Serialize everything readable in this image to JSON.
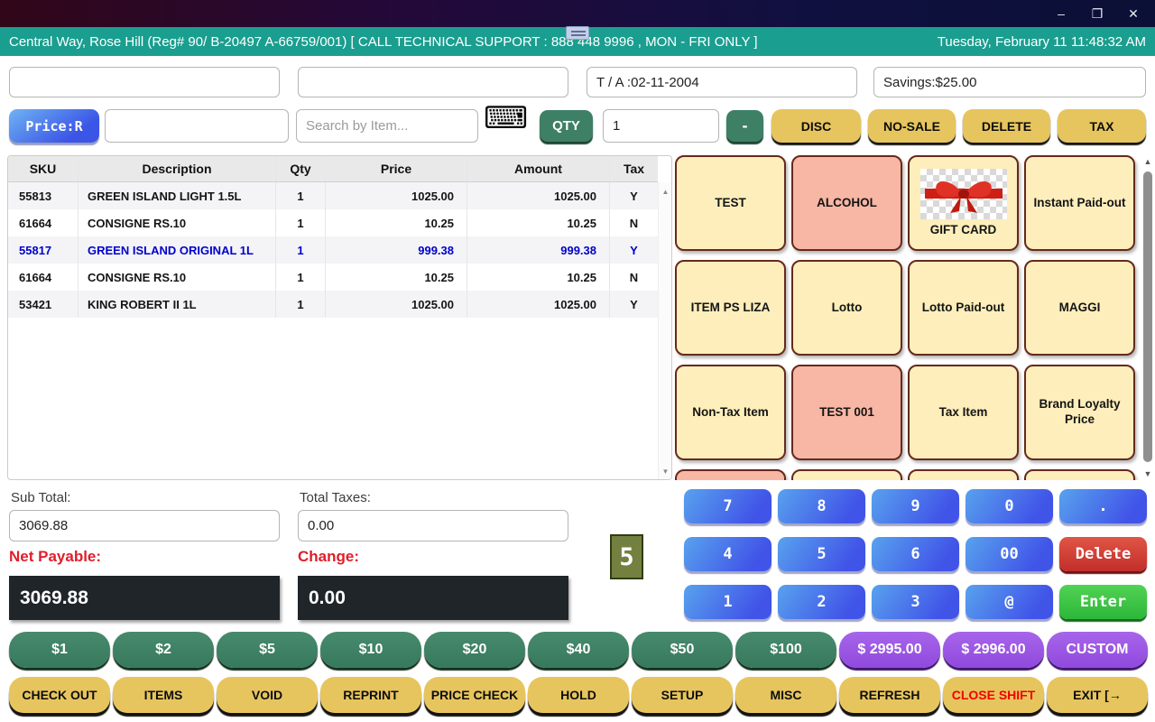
{
  "titlebar": {
    "minimize": "–",
    "restore": "❐",
    "close": "✕"
  },
  "header": {
    "store_info": "Central Way, Rose Hill (Reg# 90/ B-20497 A-66759/001) [ CALL TECHNICAL SUPPORT : 888 448 9996 , MON - FRI ONLY ]",
    "datetime": "Tuesday, February 11 11:48:32 AM"
  },
  "topbar": {
    "field1_value": "",
    "field2_value": "",
    "transaction_date": "T / A :02-11-2004",
    "savings": "Savings:$25.00"
  },
  "actionbar": {
    "price_mode": "Price:R",
    "item_code_value": "",
    "search_placeholder": "Search by Item...",
    "keyboard_icon": "⌨",
    "qty_label": "QTY",
    "qty_value": "1",
    "minus_label": "-",
    "disc": "DISC",
    "no_sale": "NO-SALE",
    "delete": "DELETE",
    "tax": "TAX"
  },
  "table": {
    "headers": [
      {
        "key": "sku",
        "label": "SKU"
      },
      {
        "key": "description",
        "label": "Description"
      },
      {
        "key": "qty",
        "label": "Qty"
      },
      {
        "key": "price",
        "label": "Price"
      },
      {
        "key": "amount",
        "label": "Amount"
      },
      {
        "key": "tax",
        "label": "Tax"
      }
    ],
    "rows": [
      {
        "sku": "55813",
        "description": "GREEN ISLAND LIGHT 1.5L",
        "qty": "1",
        "price": "1025.00",
        "amount": "1025.00",
        "tax": "Y",
        "highlighted": false
      },
      {
        "sku": "61664",
        "description": "CONSIGNE RS.10",
        "qty": "1",
        "price": "10.25",
        "amount": "10.25",
        "tax": "N",
        "highlighted": false
      },
      {
        "sku": "55817",
        "description": "GREEN ISLAND ORIGINAL 1L",
        "qty": "1",
        "price": "999.38",
        "amount": "999.38",
        "tax": "Y",
        "highlighted": true
      },
      {
        "sku": "61664",
        "description": "CONSIGNE RS.10",
        "qty": "1",
        "price": "10.25",
        "amount": "10.25",
        "tax": "N",
        "highlighted": false
      },
      {
        "sku": "53421",
        "description": "KING ROBERT II 1L",
        "qty": "1",
        "price": "1025.00",
        "amount": "1025.00",
        "tax": "Y",
        "highlighted": false
      }
    ]
  },
  "product_grid": {
    "buttons": [
      {
        "label": "TEST",
        "color": "cream"
      },
      {
        "label": "ALCOHOL",
        "color": "pink"
      },
      {
        "label": "GIFT CARD",
        "color": "cream",
        "image": "gift-bow"
      },
      {
        "label": "Instant Paid-out",
        "color": "cream"
      },
      {
        "label": "ITEM PS LIZA",
        "color": "cream"
      },
      {
        "label": "Lotto",
        "color": "cream"
      },
      {
        "label": "Lotto Paid-out",
        "color": "cream"
      },
      {
        "label": "MAGGI",
        "color": "cream"
      },
      {
        "label": "Non-Tax Item",
        "color": "cream"
      },
      {
        "label": "TEST 001",
        "color": "pink"
      },
      {
        "label": "Tax Item",
        "color": "cream"
      },
      {
        "label": "Brand Loyalty Price",
        "color": "cream"
      },
      {
        "label": "",
        "color": "pink"
      },
      {
        "label": "",
        "color": "cream"
      },
      {
        "label": "",
        "color": "cream"
      },
      {
        "label": "",
        "color": "cream"
      }
    ]
  },
  "totals": {
    "subtotal_label": "Sub Total:",
    "subtotal_value": "3069.88",
    "taxes_label": "Total Taxes:",
    "taxes_value": "0.00",
    "net_label": "Net Payable:",
    "net_value": "3069.88",
    "change_label": "Change:",
    "change_value": "0.00",
    "item_count": "5"
  },
  "keypad": {
    "keys": [
      {
        "label": "7",
        "type": "blue"
      },
      {
        "label": "8",
        "type": "blue"
      },
      {
        "label": "9",
        "type": "blue"
      },
      {
        "label": "0",
        "type": "blue"
      },
      {
        "label": ".",
        "type": "blue"
      },
      {
        "label": "4",
        "type": "blue"
      },
      {
        "label": "5",
        "type": "blue"
      },
      {
        "label": "6",
        "type": "blue"
      },
      {
        "label": "00",
        "type": "blue"
      },
      {
        "label": "Delete",
        "type": "red"
      },
      {
        "label": "1",
        "type": "blue"
      },
      {
        "label": "2",
        "type": "blue"
      },
      {
        "label": "3",
        "type": "blue"
      },
      {
        "label": "@",
        "type": "blue"
      },
      {
        "label": "Enter",
        "type": "green"
      }
    ]
  },
  "tender_row": [
    {
      "label": "$1",
      "type": "green"
    },
    {
      "label": "$2",
      "type": "green"
    },
    {
      "label": "$5",
      "type": "green"
    },
    {
      "label": "$10",
      "type": "green"
    },
    {
      "label": "$20",
      "type": "green"
    },
    {
      "label": "$40",
      "type": "green"
    },
    {
      "label": "$50",
      "type": "green"
    },
    {
      "label": "$100",
      "type": "green"
    },
    {
      "label": "$ 2995.00",
      "type": "purple"
    },
    {
      "label": "$ 2996.00",
      "type": "purple"
    },
    {
      "label": "CUSTOM",
      "type": "purple"
    }
  ],
  "function_row": [
    {
      "label": "CHECK OUT"
    },
    {
      "label": "ITEMS"
    },
    {
      "label": "VOID"
    },
    {
      "label": "REPRINT"
    },
    {
      "label": "PRICE CHECK"
    },
    {
      "label": "HOLD"
    },
    {
      "label": "SETUP"
    },
    {
      "label": "MISC"
    },
    {
      "label": "REFRESH"
    },
    {
      "label": "CLOSE SHIFT",
      "type": "alert"
    },
    {
      "label": "EXIT",
      "type": "exit",
      "icon": "exit-icon"
    }
  ],
  "colors": {
    "teal_bar": "#1a9e8f",
    "yellow_button": "#e7c55e",
    "green_button": "#3e8065",
    "purple_button": "#9b59e4",
    "keypad_blue": "#4668ea",
    "cream_tile": "#fdeebb",
    "pink_tile": "#f8b7a4",
    "highlight_row_text": "#0000cc",
    "alert_text": "#e01e2a",
    "display_bg": "#20252a"
  }
}
